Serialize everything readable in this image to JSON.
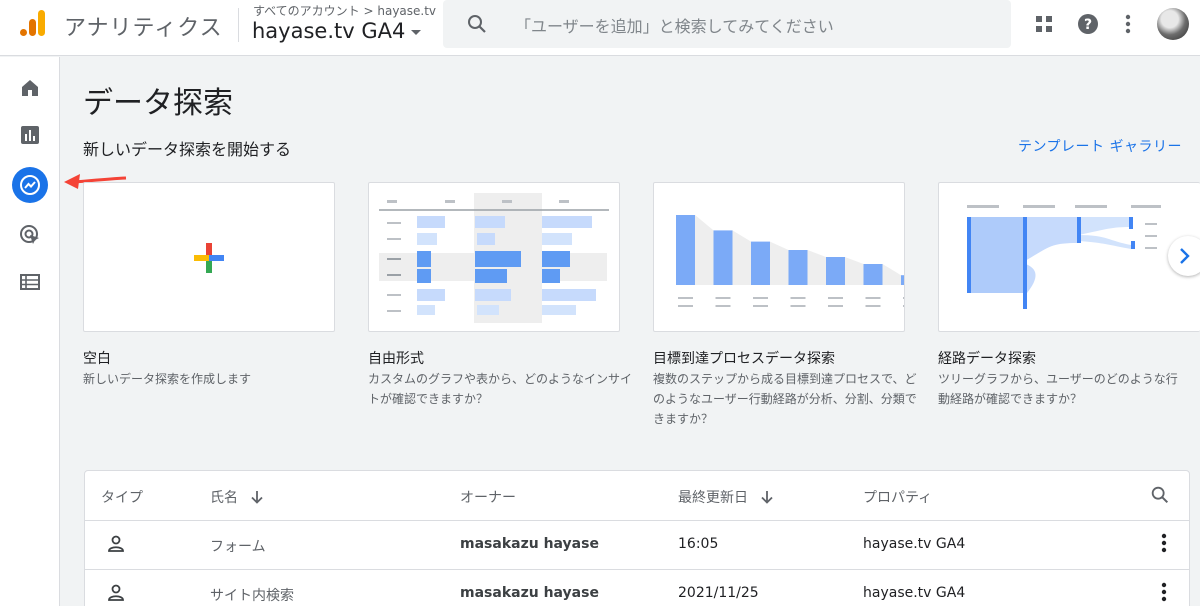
{
  "app": {
    "title": "アナリティクス",
    "breadcrumb": "すべてのアカウント > hayase.tv",
    "property": "hayase.tv GA4"
  },
  "search": {
    "placeholder": "「ユーザーを追加」と検索してみてください"
  },
  "topbar_icons": [
    "apps-grid-icon",
    "help-icon",
    "more-vert-icon",
    "account-avatar"
  ],
  "nav": [
    "home-icon",
    "reports-icon",
    "explore-icon",
    "advertising-icon",
    "configure-icon"
  ],
  "main": {
    "title": "データ探索",
    "section_title": "新しいデータ探索を開始する",
    "gallery_link": "テンプレート ギャラリー"
  },
  "templates": [
    {
      "title": "空白",
      "desc": "新しいデータ探索を作成します"
    },
    {
      "title": "自由形式",
      "desc": "カスタムのグラフや表から、どのようなインサイトが確認できますか？"
    },
    {
      "title": "目標到達プロセスデータ探索",
      "desc": "複数のステップから成る目標到達プロセスで、どのようなユーザー行動経路が分析、分割、分類できますか？"
    },
    {
      "title": "経路データ探索",
      "desc": "ツリーグラフから、ユーザーのどのような行動経路が確認できますか？"
    }
  ],
  "funnel_preview": {
    "values": [
      100,
      78,
      62,
      50,
      40,
      30,
      14
    ]
  },
  "table": {
    "headers": {
      "type": "タイプ",
      "name": "氏名",
      "owner": "オーナー",
      "updated": "最終更新日",
      "property": "プロパティ"
    },
    "rows": [
      {
        "name": "フォーム",
        "owner": "masakazu hayase",
        "updated": "16:05",
        "property": "hayase.tv GA4"
      },
      {
        "name": "サイト内検索",
        "owner": "masakazu hayase",
        "updated": "2021/11/25",
        "property": "hayase.tv GA4"
      }
    ]
  },
  "colors": {
    "accent": "#1a73e8",
    "annotation_arrow": "#f44336"
  }
}
